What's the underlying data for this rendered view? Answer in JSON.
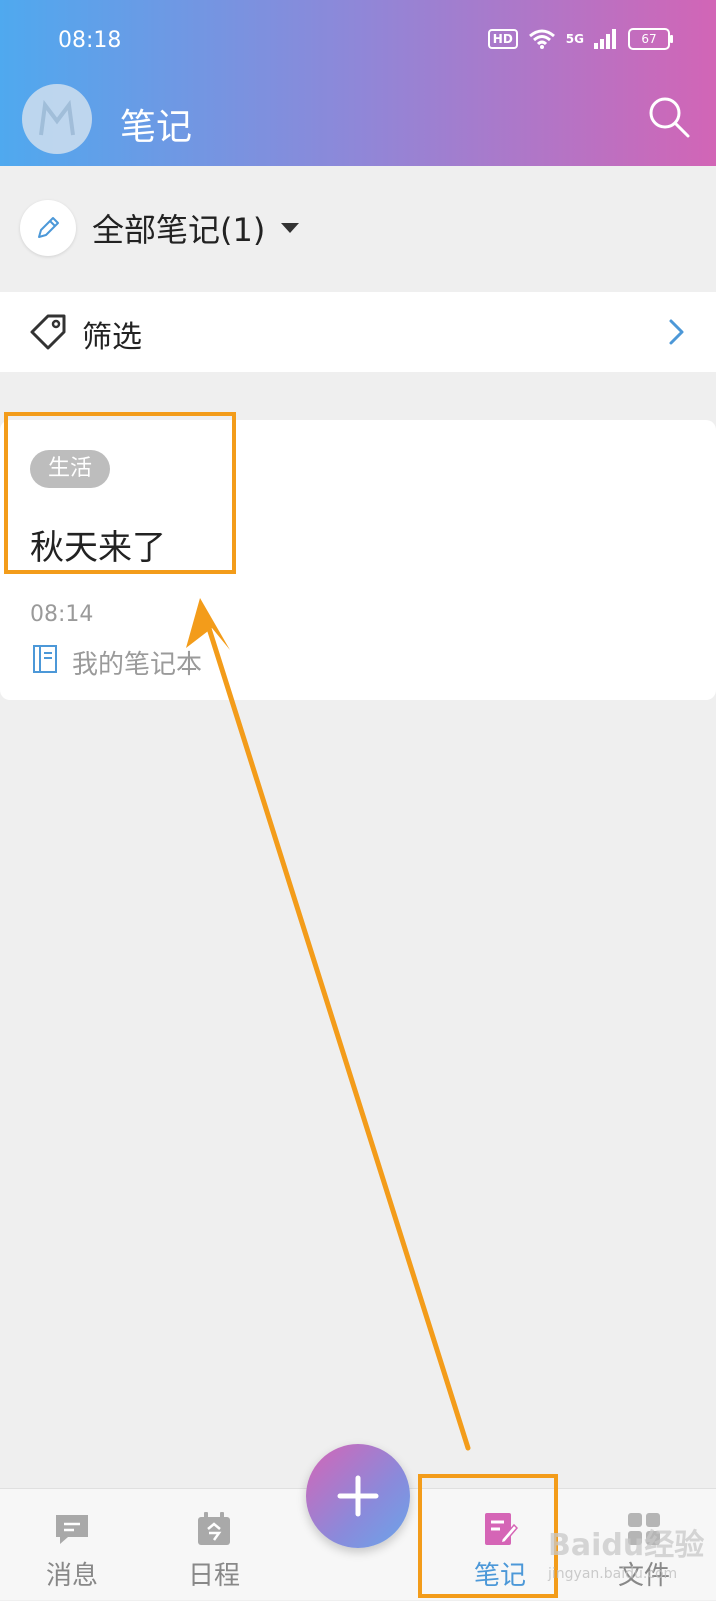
{
  "status_bar": {
    "time": "08:18",
    "hd": "HD",
    "network": "5G",
    "battery": "67"
  },
  "header": {
    "title": "笔记"
  },
  "notebook_selector": {
    "label": "全部笔记(1)"
  },
  "filter": {
    "label": "筛选"
  },
  "note": {
    "tag": "生活",
    "title": "秋天来了",
    "time": "08:14",
    "notebook": "我的笔记本"
  },
  "bottom_nav": {
    "items": [
      {
        "label": "消息"
      },
      {
        "label": "日程"
      },
      {
        "label": "笔记"
      },
      {
        "label": "文件"
      }
    ]
  },
  "watermark": {
    "text": "Baidu经验",
    "sub": "jingyan.baidu.com"
  },
  "colors": {
    "accent": "#4c98d8",
    "highlight": "#f39c1a",
    "note_icon": "#d565b6"
  }
}
